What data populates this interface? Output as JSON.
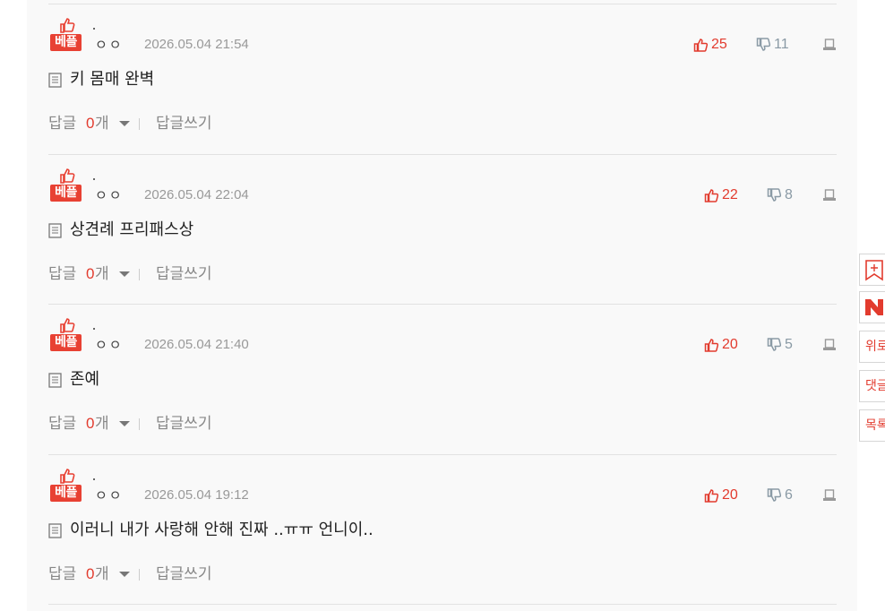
{
  "best_label": "베플",
  "reply_label": "답글",
  "reply_unit": "개",
  "write_reply_label": "답글쓰기",
  "icons": {
    "best": "thumbs-up-icon",
    "like": "thumbs-up-icon",
    "dislike": "thumbs-down-icon",
    "report": "report-icon",
    "content": "document-icon",
    "expand": "caret-down-icon"
  },
  "colors": {
    "accent": "#e23b2e",
    "best_badge": "#e84133",
    "dislike": "#8a9aa5"
  },
  "comments": [
    {
      "nickname": "ㅇㅇ",
      "date": "2026.05.04 21:54",
      "likes": "25",
      "dislikes": "11",
      "text": "키 몸매 완벽",
      "reply_count": "0"
    },
    {
      "nickname": "ㅇㅇ",
      "date": "2026.05.04 22:04",
      "likes": "22",
      "dislikes": "8",
      "text": "상견례 프리패스상",
      "reply_count": "0"
    },
    {
      "nickname": "ㅇㅇ",
      "date": "2026.05.04 21:40",
      "likes": "20",
      "dislikes": "5",
      "text": "존예",
      "reply_count": "0"
    },
    {
      "nickname": "ㅇㅇ",
      "date": "2026.05.04 19:12",
      "likes": "20",
      "dislikes": "6",
      "text": "이러니 내가 사랑해 안해 진짜 ..ㅠㅠ 언니이..",
      "reply_count": "0"
    }
  ],
  "sidebar": {
    "bookmark_icon": "bookmark-icon",
    "naver_icon": "naver-icon",
    "top_label": "위로",
    "comments_label": "댓글",
    "list_label": "목록"
  }
}
